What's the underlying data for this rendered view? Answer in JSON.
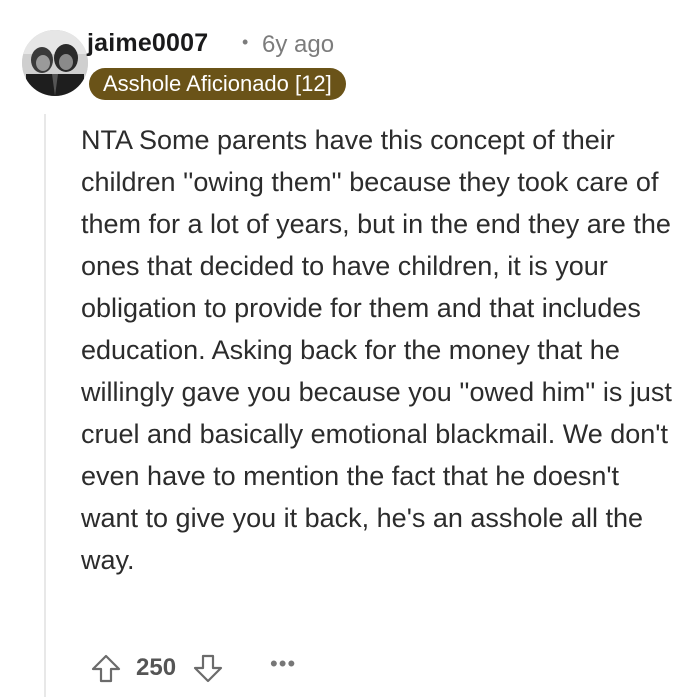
{
  "comment": {
    "author": "jaime0007",
    "separator": "•",
    "age": "6y ago",
    "flair": "Asshole Aficionado [12]",
    "body": "NTA Some parents have this concept of their children ''owing them'' because they took care of them for a lot of years, but in the end they are the ones that decided to have children, it is your obligation to provide for them and that includes education. Asking back for the money that he willingly gave you because you ''owed him'' is just cruel and basically emotional blackmail. We don't even have to mention the fact that he doesn't want to give you it back, he's an asshole all the way.",
    "score": "250",
    "more_label": "•••"
  },
  "colors": {
    "flair_bg": "#6a5318",
    "flair_text": "#ffffff",
    "meta_text": "#7c7c7c"
  },
  "icons": {
    "upvote": "arrow-up-outline",
    "downvote": "arrow-down-outline",
    "more": "horizontal-ellipsis"
  }
}
